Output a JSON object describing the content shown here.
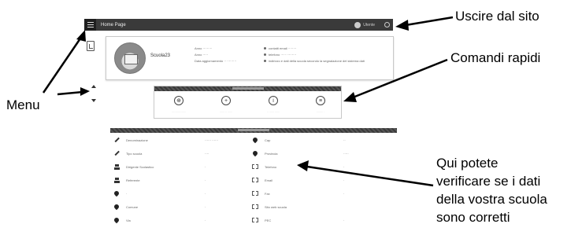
{
  "topbar": {
    "title": "Home Page",
    "user_label": "Utente"
  },
  "school": {
    "name": "Scuola23",
    "info": [
      "Anno ·········",
      "Anno ·····",
      "Data aggiornamento ·· ·········"
    ],
    "contacts": [
      "contatti email ········",
      "telefono ····· ·········",
      "indirizzo e dati della scuola secondo la segnalazione del sistema dati"
    ]
  },
  "quick_commands": [
    {
      "icon": "download-icon",
      "glyph": "⊕",
      "label": "···· ······· ······"
    },
    {
      "icon": "add-icon",
      "glyph": "+",
      "label": "······ ·· ······"
    },
    {
      "icon": "info-icon",
      "glyph": "i",
      "label": "·· ······ ······"
    },
    {
      "icon": "archive-icon",
      "glyph": "≡",
      "label": "········ ·"
    }
  ],
  "data_table": {
    "left_rows": [
      {
        "icon": "pen-icon",
        "label": "Denominazione",
        "value": "······ ······"
      },
      {
        "icon": "pen-icon",
        "label": "Tipo scuola",
        "value": "····"
      },
      {
        "icon": "people-icon",
        "label": "Dirigente Scolastico",
        "value": "·"
      },
      {
        "icon": "people-icon",
        "label": "Referente",
        "value": "·"
      },
      {
        "icon": "pin-icon",
        "label": "·",
        "value": "·"
      },
      {
        "icon": "pin-icon",
        "label": "Comune",
        "value": "·"
      },
      {
        "icon": "pin-icon",
        "label": "Via",
        "value": "·"
      }
    ],
    "right_rows": [
      {
        "icon": "pin-icon",
        "label": "Cap",
        "value": "··"
      },
      {
        "icon": "pin-icon",
        "label": "Provincia",
        "value": "·····"
      },
      {
        "icon": "box-icon",
        "label": "Telefono",
        "value": "·"
      },
      {
        "icon": "box-icon",
        "label": "Email",
        "value": "·"
      },
      {
        "icon": "box-icon",
        "label": "Fax",
        "value": "·"
      },
      {
        "icon": "box-icon",
        "label": "Sito web scuola",
        "value": ""
      },
      {
        "icon": "box-icon",
        "label": "PEC",
        "value": "·"
      }
    ]
  },
  "annotations": {
    "exit": "Uscire dal sito",
    "commands": "Comandi rapidi",
    "menu": "Menu",
    "data_lines": [
      "Qui potete",
      "verificare se i dati",
      "della vostra scuola",
      "sono corretti"
    ]
  }
}
